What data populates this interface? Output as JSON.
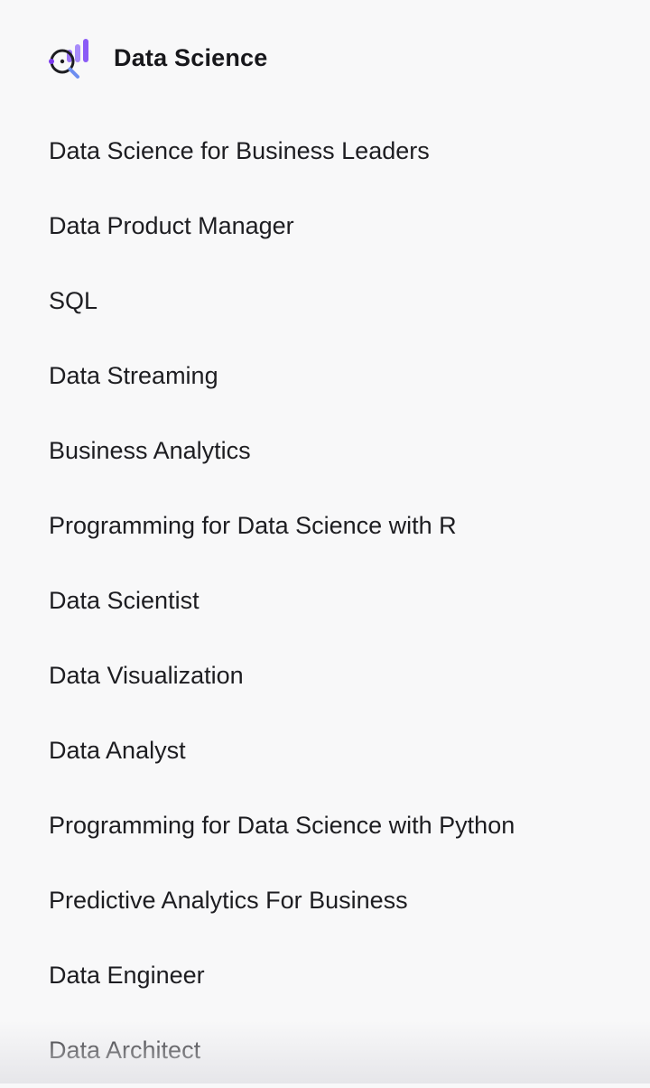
{
  "header": {
    "title": "Data Science",
    "icon": "data-science-icon"
  },
  "colors": {
    "accent_purple": "#8b5cf6",
    "accent_violet": "#6d3df0",
    "text": "#1d1d21",
    "background": "#f8f8f9"
  },
  "menu": {
    "items": [
      {
        "label": "Data Science for Business Leaders"
      },
      {
        "label": "Data Product Manager"
      },
      {
        "label": "SQL"
      },
      {
        "label": "Data Streaming"
      },
      {
        "label": "Business Analytics"
      },
      {
        "label": "Programming for Data Science with R"
      },
      {
        "label": "Data Scientist"
      },
      {
        "label": "Data Visualization"
      },
      {
        "label": "Data Analyst"
      },
      {
        "label": "Programming for Data Science with Python"
      },
      {
        "label": "Predictive Analytics For Business"
      },
      {
        "label": "Data Engineer"
      },
      {
        "label": "Data Architect"
      }
    ]
  }
}
